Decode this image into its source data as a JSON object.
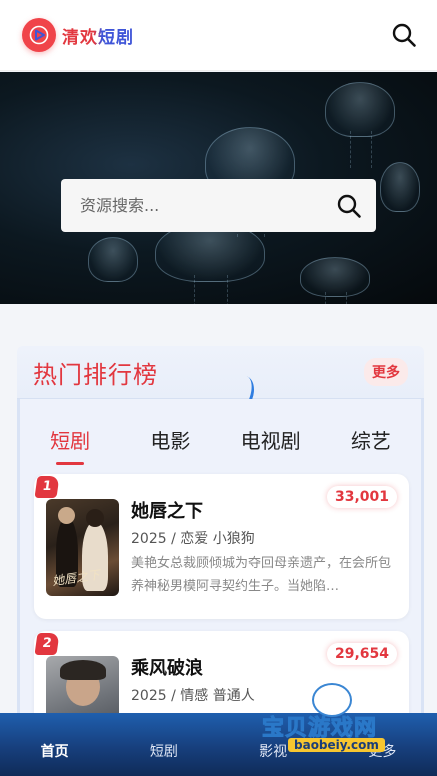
{
  "header": {
    "brand": "清欢短剧",
    "logo_icon": "play-logo-icon",
    "search_icon": "search-icon"
  },
  "hero": {
    "search_placeholder": "资源搜索...",
    "search_icon": "search-icon"
  },
  "ranking": {
    "title": "热门排行榜",
    "more_label": "更多",
    "tabs": [
      {
        "label": "短剧",
        "active": true
      },
      {
        "label": "电影",
        "active": false
      },
      {
        "label": "电视剧",
        "active": false
      },
      {
        "label": "综艺",
        "active": false
      }
    ],
    "items": [
      {
        "rank": "1",
        "title": "她唇之下",
        "meta": "2025 / 恋爱 小狼狗",
        "desc": "美艳女总裁顾倾城为夺回母亲遗产，在会所包养神秘男模阿寻契约生子。当她陷…",
        "count": "33,001",
        "poster_text": "她唇之下"
      },
      {
        "rank": "2",
        "title": "乘风破浪",
        "meta": "2025 / 情感 普通人",
        "count": "29,654"
      }
    ]
  },
  "bottom_nav": [
    {
      "label": "首页",
      "active": true
    },
    {
      "label": "短剧",
      "active": false
    },
    {
      "label": "影视",
      "active": false
    },
    {
      "label": "更多",
      "active": false
    }
  ],
  "watermark": {
    "text": "宝贝游戏网",
    "url": "baobeiy.com"
  },
  "colors": {
    "accent": "#e2373f",
    "brand_blue": "#3f55d8",
    "nav_blue": "#1f5fae"
  }
}
